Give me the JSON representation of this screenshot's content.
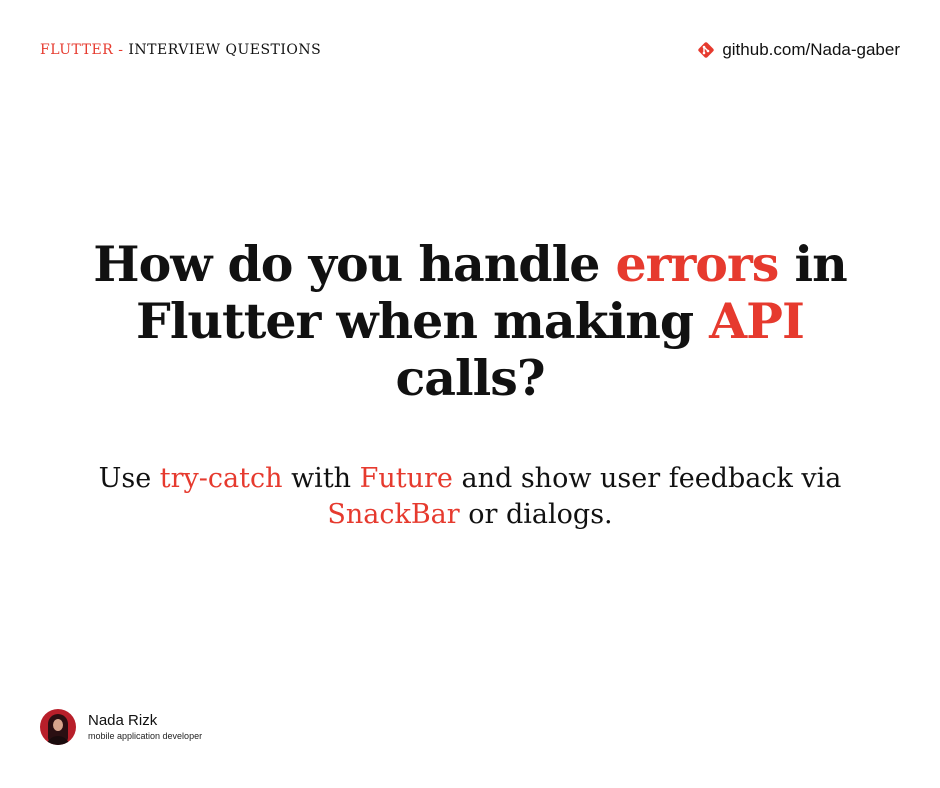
{
  "header": {
    "topic": "FLUTTER",
    "separator": " - ",
    "series": "INTERVIEW QUESTIONS",
    "github_icon": "git-icon",
    "github_link": "github.com/Nada-gaber"
  },
  "question": {
    "part1": "How do you handle ",
    "highlight1": "errors",
    "part2": " in Flutter when making ",
    "highlight2": "API",
    "part3": " calls?"
  },
  "answer": {
    "part1": "Use ",
    "highlight1": "try-catch",
    "part2": " with ",
    "highlight2": "Future",
    "part3": " and show user feedback via ",
    "highlight3": "SnackBar",
    "part4": " or dialogs."
  },
  "author": {
    "name": "Nada Rizk",
    "role": "mobile application developer"
  },
  "colors": {
    "accent": "#e63a2e",
    "text": "#111111",
    "background": "#ffffff"
  }
}
